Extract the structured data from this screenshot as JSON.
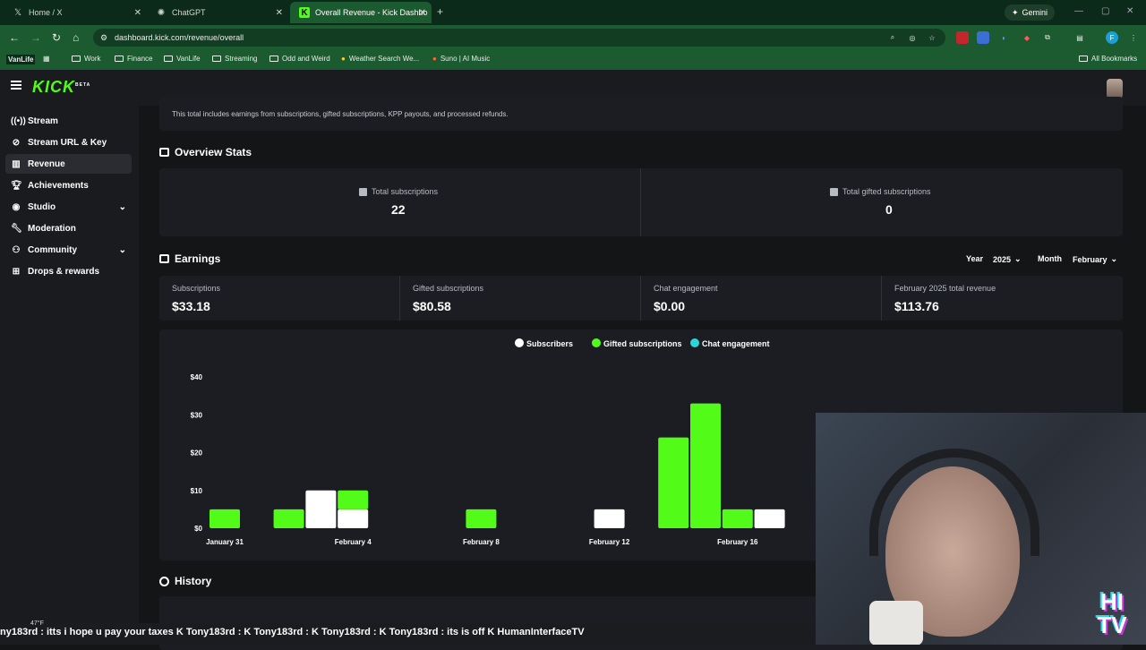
{
  "browser": {
    "tabs": [
      {
        "title": "Home / X",
        "icon": "x-logo-icon"
      },
      {
        "title": "ChatGPT",
        "icon": "chatgpt-icon"
      },
      {
        "title": "Overall Revenue - Kick Dashbo",
        "icon": "kick-icon",
        "active": true
      }
    ],
    "gemini_label": "Gemini",
    "url": "dashboard.kick.com/revenue/overall",
    "bookmarks": [
      "VanLife",
      "Work",
      "Finance",
      "VanLife",
      "Streaming",
      "Odd and Weird",
      "Weather Search We...",
      "Suno | AI Music"
    ],
    "all_bookmarks": "All Bookmarks"
  },
  "app": {
    "logo": "KICK",
    "logo_badge": "BETA",
    "sidebar": {
      "items": [
        {
          "label": "Stream",
          "icon": "broadcast-icon"
        },
        {
          "label": "Stream URL & Key",
          "icon": "link-icon"
        },
        {
          "label": "Revenue",
          "icon": "chart-icon",
          "active": true
        },
        {
          "label": "Achievements",
          "icon": "trophy-icon"
        },
        {
          "label": "Studio",
          "icon": "studio-icon",
          "expandable": true
        },
        {
          "label": "Moderation",
          "icon": "wrench-icon"
        },
        {
          "label": "Community",
          "icon": "community-icon",
          "expandable": true
        },
        {
          "label": "Drops & rewards",
          "icon": "gift-icon"
        }
      ]
    },
    "notice": "This total includes earnings from subscriptions, gifted subscriptions, KPP payouts, and processed refunds.",
    "overview": {
      "title": "Overview Stats",
      "total_subscriptions_label": "Total subscriptions",
      "total_subscriptions": "22",
      "total_gifted_label": "Total gifted subscriptions",
      "total_gifted": "0"
    },
    "earnings": {
      "title": "Earnings",
      "year_label": "Year",
      "year_value": "2025",
      "month_label": "Month",
      "month_value": "February",
      "cards": [
        {
          "label": "Subscriptions",
          "value": "$33.18"
        },
        {
          "label": "Gifted subscriptions",
          "value": "$80.58"
        },
        {
          "label": "Chat engagement",
          "value": "$0.00"
        },
        {
          "label": "February 2025 total revenue",
          "value": "$113.76"
        }
      ]
    },
    "history_title": "History"
  },
  "chart_data": {
    "type": "bar",
    "stacked": true,
    "legend": [
      "Subscribers",
      "Gifted subscriptions",
      "Chat engagement"
    ],
    "legend_colors": [
      "#ffffff",
      "#53fc18",
      "#2ad6d6"
    ],
    "legend_placement": "top-center",
    "y_ticks": [
      "$0",
      "$10",
      "$20",
      "$30",
      "$40"
    ],
    "ylim": [
      0,
      40
    ],
    "x_tick_labels": [
      "January 31",
      "February 4",
      "February 8",
      "February 12",
      "February 16"
    ],
    "bars": [
      {
        "index": 0,
        "subscribers": 0,
        "gifted": 5
      },
      {
        "index": 2,
        "subscribers": 0,
        "gifted": 5
      },
      {
        "index": 3,
        "subscribers": 10,
        "gifted": 0
      },
      {
        "index": 4,
        "subscribers": 5,
        "gifted": 5
      },
      {
        "index": 8,
        "subscribers": 0,
        "gifted": 5
      },
      {
        "index": 12,
        "subscribers": 5,
        "gifted": 0
      },
      {
        "index": 14,
        "subscribers": 0,
        "gifted": 24
      },
      {
        "index": 15,
        "subscribers": 0,
        "gifted": 33
      },
      {
        "index": 16,
        "subscribers": 0,
        "gifted": 5
      },
      {
        "index": 17,
        "subscribers": 5,
        "gifted": 0
      }
    ]
  },
  "overlay": {
    "ticker": "ny183rd : itts i hope u pay your taxes   K  Tony183rd :   K  Tony183rd :   K  Tony183rd :   K  Tony183rd : its is off   K  HumanInterfaceTV",
    "weather": "47°F",
    "logo_text": "HI TV"
  }
}
